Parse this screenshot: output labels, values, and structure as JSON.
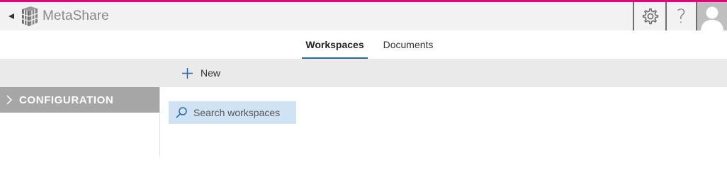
{
  "colors": {
    "accent": "#e6007e",
    "tab_underline": "#2b6aa0",
    "sidebar_active": "#a6a6a6",
    "search_bg": "#cfe3f4"
  },
  "header": {
    "app_title": "MetaShare",
    "back_icon": "back-arrow-icon",
    "logo_icon": "cube-logo-icon",
    "settings_icon": "gear-icon",
    "help_label": "?",
    "avatar_icon": "user-avatar-icon"
  },
  "tabs": [
    {
      "label": "Workspaces",
      "active": true
    },
    {
      "label": "Documents",
      "active": false
    }
  ],
  "actions": {
    "new_label": "New",
    "new_icon": "plus-icon"
  },
  "sidebar": {
    "items": [
      {
        "label": "CONFIGURATION",
        "icon": "chevron-right-icon"
      }
    ]
  },
  "search": {
    "placeholder": "Search workspaces",
    "value": "",
    "icon": "search-icon"
  }
}
